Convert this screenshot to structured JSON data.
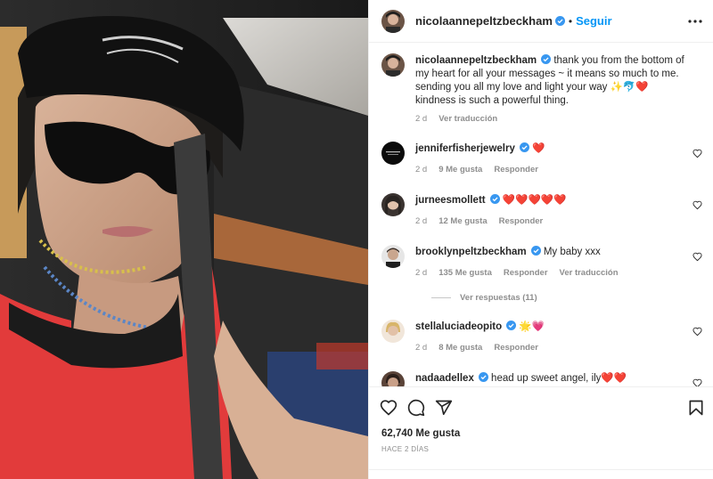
{
  "post": {
    "author": "nicolaannepeltzbeckham",
    "follow_label": "Seguir",
    "caption": "thank you from the bottom of my heart for all your messages ~ it means so much to me. sending you all my love and light your way ✨🐬❤️ kindness is such a powerful thing.",
    "caption_time": "2 d",
    "translate_label": "Ver traducción"
  },
  "comments": [
    {
      "user": "jenniferfisherjewelry",
      "text": "❤️",
      "time": "2 d",
      "likes": "9 Me gusta",
      "reply": "Responder"
    },
    {
      "user": "jurneesmollett",
      "text": "❤️❤️❤️❤️❤️",
      "time": "2 d",
      "likes": "12 Me gusta",
      "reply": "Responder"
    },
    {
      "user": "brooklynpeltzbeckham",
      "text": "My baby xxx",
      "time": "2 d",
      "likes": "135 Me gusta",
      "reply": "Responder",
      "translate": "Ver traducción",
      "view_replies": "Ver respuestas (11)"
    },
    {
      "user": "stellaluciadeopito",
      "text": "🌟💗",
      "time": "2 d",
      "likes": "8 Me gusta",
      "reply": "Responder"
    },
    {
      "user": "nadaadellex",
      "text": "head up sweet angel, ily❤️❤️"
    }
  ],
  "footer": {
    "likes": "62,740 Me gusta",
    "time_ago": "HACE 2 DÍAS"
  },
  "icons": [
    "heart-icon",
    "comment-icon",
    "share-icon",
    "save-icon",
    "more-icon",
    "verified-icon"
  ],
  "colors": {
    "accent": "#0095f6",
    "verified": "#3897f0",
    "muted": "#8e8e8e",
    "text": "#262626"
  }
}
